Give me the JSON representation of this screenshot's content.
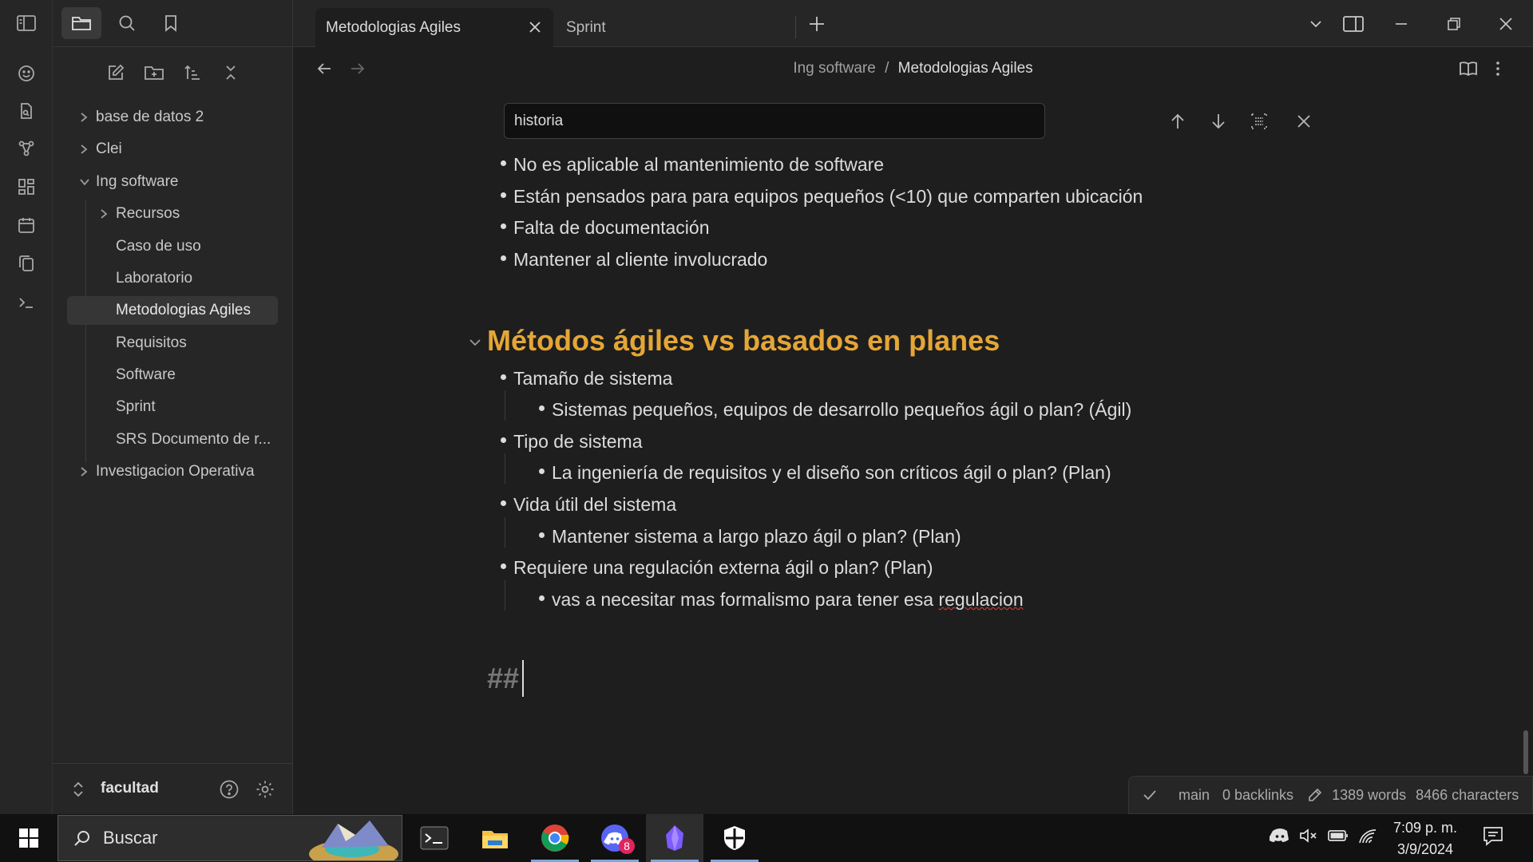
{
  "tabs": [
    {
      "label": "Metodologias Agiles",
      "active": true
    },
    {
      "label": "Sprint",
      "active": false
    }
  ],
  "breadcrumb": {
    "parent": "Ing software",
    "separator": "/",
    "current": "Metodologias Agiles"
  },
  "search": {
    "value": "historia"
  },
  "sidebar": {
    "tree": [
      {
        "label": "base de datos 2",
        "type": "folder",
        "expanded": false
      },
      {
        "label": "Clei",
        "type": "folder",
        "expanded": false
      },
      {
        "label": "Ing software",
        "type": "folder",
        "expanded": true
      },
      {
        "label": "Recursos",
        "type": "folder",
        "expanded": false
      },
      {
        "label": "Caso de uso",
        "type": "file"
      },
      {
        "label": "Laboratorio",
        "type": "file"
      },
      {
        "label": "Metodologias Agiles",
        "type": "file",
        "active": true
      },
      {
        "label": "Requisitos",
        "type": "file"
      },
      {
        "label": "Software",
        "type": "file"
      },
      {
        "label": "Sprint",
        "type": "file"
      },
      {
        "label": "SRS Documento de r...",
        "type": "file"
      },
      {
        "label": "Investigacion Operativa",
        "type": "folder",
        "expanded": false
      }
    ],
    "vault_name": "facultad"
  },
  "editor": {
    "top_bullets": [
      "No es aplicable al mantenimiento de software",
      "Están pensados para para equipos pequeños (<10) que comparten ubicación",
      "Falta de documentación",
      "Mantener al cliente involucrado"
    ],
    "heading": "Métodos ágiles vs basados en planes",
    "section": [
      {
        "text": "Tamaño de sistema",
        "child": "Sistemas pequeños, equipos de desarrollo pequeños ágil o plan? (Ágil)"
      },
      {
        "text": "Tipo de sistema",
        "child": "La ingeniería de requisitos y el diseño son críticos ágil o plan? (Plan)"
      },
      {
        "text": "Vida útil del sistema",
        "child": "Mantener sistema a largo plazo ágil o plan? (Plan)"
      },
      {
        "text": "Requiere una regulación externa ágil o plan? (Plan)",
        "child_prefix": "vas a necesitar mas formalismo para tener esa ",
        "child_misspelled": "regulacion"
      }
    ],
    "typing": "##"
  },
  "status": {
    "branch": "main",
    "backlinks": "0 backlinks",
    "words": "1389 words",
    "characters": "8466 characters"
  },
  "taskbar": {
    "search_placeholder": "Buscar",
    "discord_badge": "8",
    "time": "7:09 p. m.",
    "date": "3/9/2024"
  },
  "colors": {
    "accent_heading": "#e5a636",
    "background": "#1e1e1e",
    "panel": "#262626"
  }
}
